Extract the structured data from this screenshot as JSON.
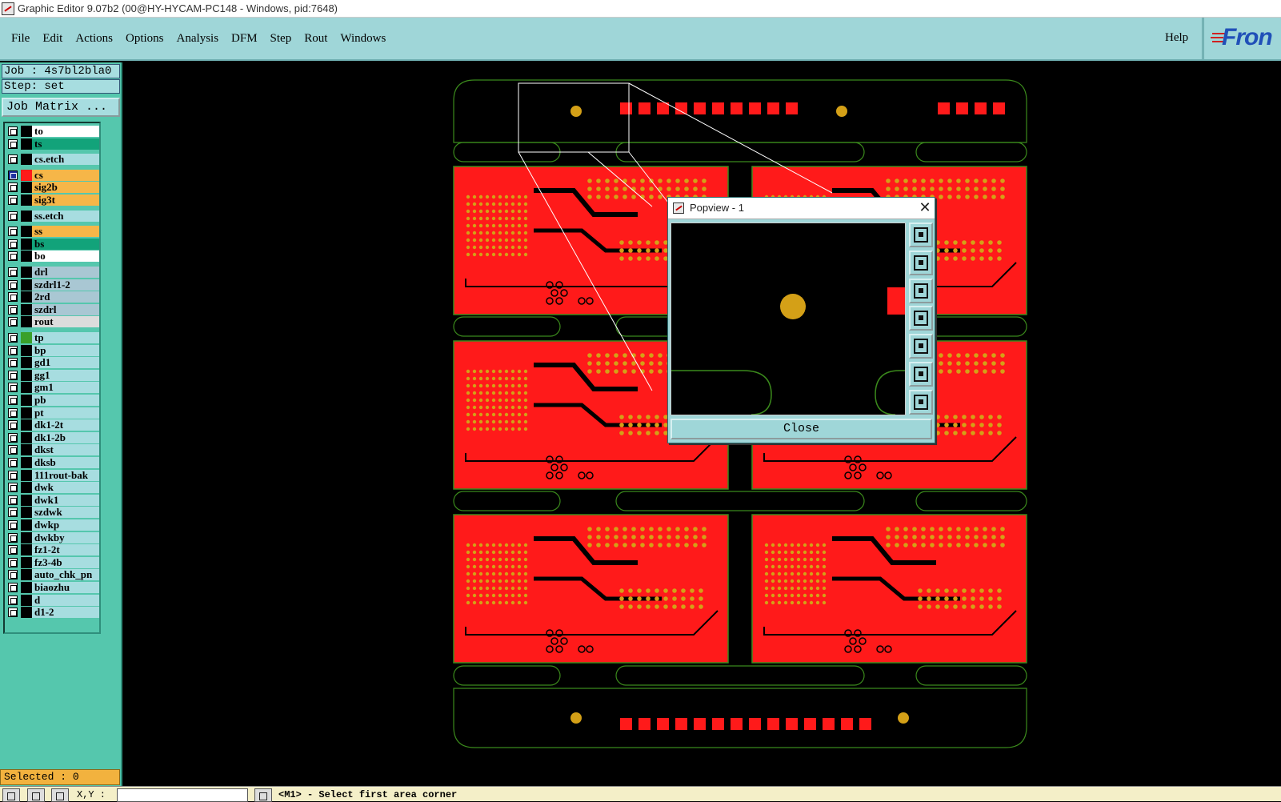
{
  "window": {
    "title": "Graphic Editor 9.07b2 (00@HY-HYCAM-PC148 - Windows, pid:7648)"
  },
  "menu": {
    "items": [
      {
        "label": "File",
        "underline": "F"
      },
      {
        "label": "Edit",
        "underline": "E"
      },
      {
        "label": "Actions",
        "underline": "A"
      },
      {
        "label": "Options",
        "underline": "O"
      },
      {
        "label": "Analysis",
        "underline": "A"
      },
      {
        "label": "DFM",
        "underline": "D"
      },
      {
        "label": "Step",
        "underline": "S"
      },
      {
        "label": "Rout",
        "underline": "R"
      },
      {
        "label": "Windows",
        "underline": "W"
      }
    ],
    "help": "Help",
    "logo": "Fron"
  },
  "panel": {
    "job": "Job : 4s7bl2bla0",
    "step": "Step: set",
    "job_matrix": "Job Matrix ...",
    "selected": "Selected : 0"
  },
  "layers": [
    {
      "name": "to",
      "color": "#ffffff",
      "active": false
    },
    {
      "name": "ts",
      "color": "#12a37a",
      "active": false
    },
    {
      "name": "cs.etch",
      "color": "#a7dde0",
      "active": false
    },
    {
      "name": "cs",
      "color": "#f6b648",
      "active": true,
      "swatch": "#ff1a1a"
    },
    {
      "name": "sig2b",
      "color": "#f6b648",
      "active": false
    },
    {
      "name": "sig3t",
      "color": "#f6b648",
      "active": false
    },
    {
      "name": "ss.etch",
      "color": "#a7dde0",
      "active": false
    },
    {
      "name": "ss",
      "color": "#f6b648",
      "active": false
    },
    {
      "name": "bs",
      "color": "#12a37a",
      "active": false
    },
    {
      "name": "bo",
      "color": "#ffffff",
      "active": false
    },
    {
      "name": "drl",
      "color": "#a9c7d3",
      "active": false
    },
    {
      "name": "szdrl1-2",
      "color": "#a9c7d3",
      "active": false
    },
    {
      "name": "2rd",
      "color": "#a9c7d3",
      "active": false
    },
    {
      "name": "szdrl",
      "color": "#a9c7d3",
      "active": false
    },
    {
      "name": "rout",
      "color": "#dcdcdc",
      "active": false
    },
    {
      "name": "tp",
      "color": "#a7dde0",
      "active": false,
      "swatch": "#3aa02a"
    },
    {
      "name": "bp",
      "color": "#a7dde0",
      "active": false
    },
    {
      "name": "gd1",
      "color": "#a7dde0",
      "active": false
    },
    {
      "name": "gg1",
      "color": "#a7dde0",
      "active": false
    },
    {
      "name": "gm1",
      "color": "#a7dde0",
      "active": false
    },
    {
      "name": "pb",
      "color": "#a7dde0",
      "active": false
    },
    {
      "name": "pt",
      "color": "#a7dde0",
      "active": false
    },
    {
      "name": "dk1-2t",
      "color": "#a7dde0",
      "active": false
    },
    {
      "name": "dk1-2b",
      "color": "#a7dde0",
      "active": false
    },
    {
      "name": "dkst",
      "color": "#a7dde0",
      "active": false
    },
    {
      "name": "dksb",
      "color": "#a7dde0",
      "active": false
    },
    {
      "name": "111rout-bak",
      "color": "#a7dde0",
      "active": false
    },
    {
      "name": "dwk",
      "color": "#a7dde0",
      "active": false
    },
    {
      "name": "dwk1",
      "color": "#a7dde0",
      "active": false
    },
    {
      "name": "szdwk",
      "color": "#a7dde0",
      "active": false
    },
    {
      "name": "dwkp",
      "color": "#a7dde0",
      "active": false
    },
    {
      "name": "dwkby",
      "color": "#a7dde0",
      "active": false
    },
    {
      "name": "fz1-2t",
      "color": "#a7dde0",
      "active": false
    },
    {
      "name": "fz3-4b",
      "color": "#a7dde0",
      "active": false
    },
    {
      "name": "auto_chk_pn",
      "color": "#a7dde0",
      "active": false
    },
    {
      "name": "biaozhu",
      "color": "#a7dde0",
      "active": false
    },
    {
      "name": "d",
      "color": "#a7dde0",
      "active": false
    },
    {
      "name": "d1-2",
      "color": "#a7dde0",
      "active": false
    }
  ],
  "popview": {
    "title": "Popview - 1",
    "close_label": "Close",
    "tools": [
      "zoom-fit-icon",
      "pan-up-icon",
      "pan-down-icon",
      "pan-left-icon",
      "pan-right-icon",
      "zoom-out-icon",
      "zoom-in-icon"
    ]
  },
  "bottom": {
    "xy_label": "X,Y :",
    "xy_value": "",
    "status": "<M1> - Select first area corner"
  },
  "colors": {
    "panel_bg": "#55c7ad",
    "menu_bg": "#9fd6d8",
    "copper": "#ff1a1a",
    "pad": "#d4a017",
    "outline": "#3b8a1c"
  }
}
